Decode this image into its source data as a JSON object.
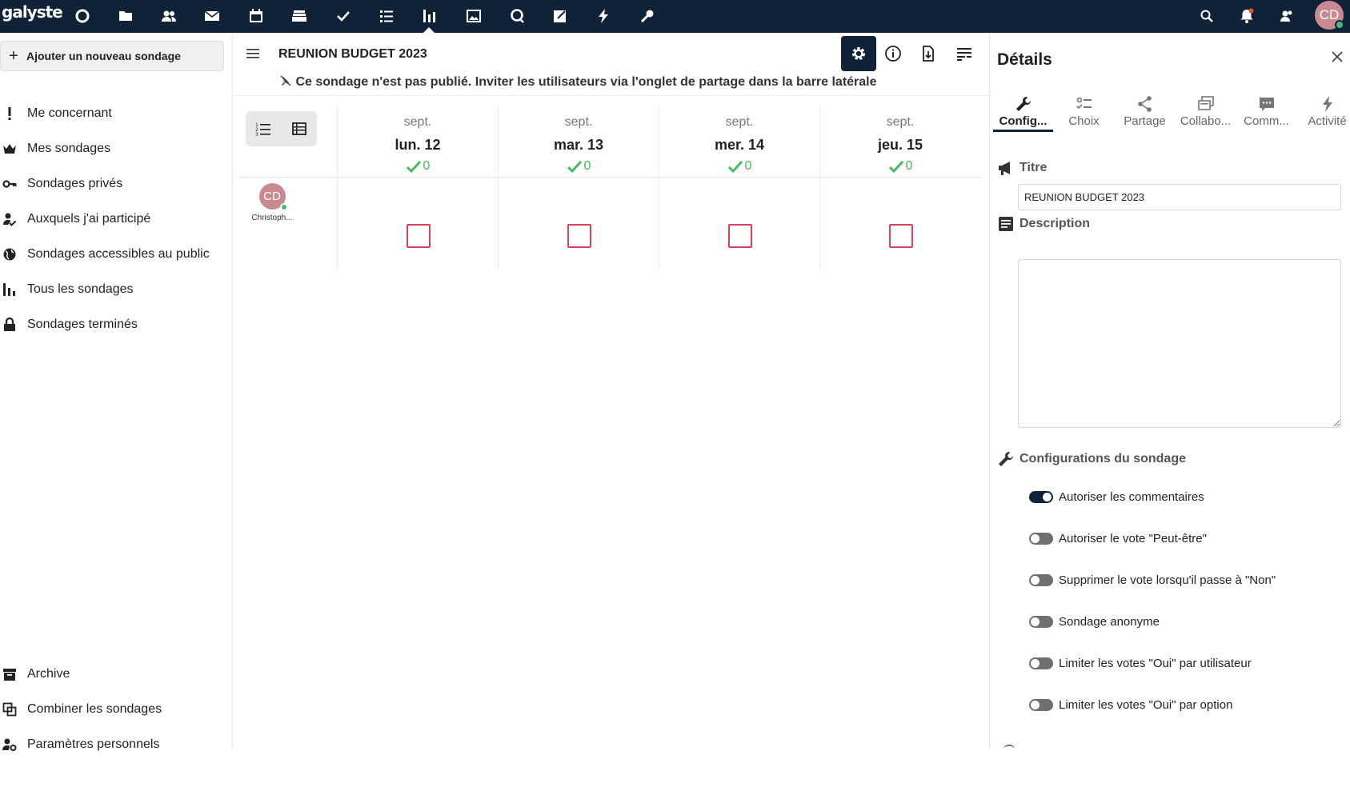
{
  "topbar": {
    "logo": "galyste",
    "apps": [
      {
        "icon": "dashboard-icon"
      },
      {
        "icon": "files-icon"
      },
      {
        "icon": "contacts-icon"
      },
      {
        "icon": "mail-icon"
      },
      {
        "icon": "calendar-icon"
      },
      {
        "icon": "deck-icon"
      },
      {
        "icon": "tasks-icon"
      },
      {
        "icon": "list-icon"
      },
      {
        "icon": "polls-icon"
      },
      {
        "icon": "photos-icon"
      },
      {
        "icon": "talk-icon"
      },
      {
        "icon": "notes-icon"
      },
      {
        "icon": "activity-icon"
      },
      {
        "icon": "passwords-icon"
      }
    ],
    "active_app": "polls-icon",
    "avatar_initials": "CD",
    "colors": {
      "bar": "#0f2238",
      "avatar": "#c98991",
      "online": "#49b382",
      "notification": "#e9532f"
    }
  },
  "sidebar": {
    "add_label": "Ajouter un nouveau sondage",
    "items": [
      {
        "label": "Me concernant",
        "icon": "exclamation-icon"
      },
      {
        "label": "Mes sondages",
        "icon": "crown-icon"
      },
      {
        "label": "Sondages privés",
        "icon": "key-icon"
      },
      {
        "label": "Auxquels j'ai participé",
        "icon": "account-check-icon"
      },
      {
        "label": "Sondages accessibles au public",
        "icon": "globe-icon"
      },
      {
        "label": "Tous les sondages",
        "icon": "bar-chart-icon"
      },
      {
        "label": "Sondages terminés",
        "icon": "lock-icon"
      }
    ],
    "bottom_items": [
      {
        "label": "Archive",
        "icon": "archive-icon"
      },
      {
        "label": "Combiner les sondages",
        "icon": "combine-icon"
      },
      {
        "label": "Paramètres personnels",
        "icon": "user-settings-icon"
      }
    ]
  },
  "main": {
    "title": "REUNION BUDGET 2023",
    "notice": "Ce sondage n'est pas publié. Inviter les utilisateurs via l'onglet de partage dans la barre latérale",
    "columns": [
      {
        "month": "sept.",
        "day": "lun. 12",
        "yes_count": "0"
      },
      {
        "month": "sept.",
        "day": "mar. 13",
        "yes_count": "0"
      },
      {
        "month": "sept.",
        "day": "mer. 14",
        "yes_count": "0"
      },
      {
        "month": "sept.",
        "day": "jeu. 15",
        "yes_count": "0"
      }
    ],
    "participant": {
      "initials": "CD",
      "name": "Christoph..."
    },
    "colors": {
      "yes": "#46ba61",
      "vote_box": "#e0405b"
    }
  },
  "details": {
    "title": "Détails",
    "tabs": [
      {
        "label": "Config...",
        "icon": "wrench-icon"
      },
      {
        "label": "Choix",
        "icon": "choices-icon"
      },
      {
        "label": "Partage",
        "icon": "share-icon"
      },
      {
        "label": "Collabo...",
        "icon": "collaboration-icon"
      },
      {
        "label": "Comm...",
        "icon": "comment-icon"
      },
      {
        "label": "Activité",
        "icon": "lightning-icon"
      }
    ],
    "title_section": "Titre",
    "title_value": "REUNION BUDGET 2023",
    "description_section": "Description",
    "description_value": "",
    "config_section": "Configurations du sondage",
    "toggles": [
      {
        "label": "Autoriser les commentaires",
        "on": true
      },
      {
        "label": "Autoriser le vote \"Peut-être\"",
        "on": false
      },
      {
        "label": "Supprimer le vote lorsqu'il passe à \"Non\"",
        "on": false
      },
      {
        "label": "Sondage anonyme",
        "on": false
      },
      {
        "label": "Limiter les votes \"Oui\" par utilisateur",
        "on": false
      },
      {
        "label": "Limiter les votes \"Oui\" par option",
        "on": false
      }
    ]
  }
}
